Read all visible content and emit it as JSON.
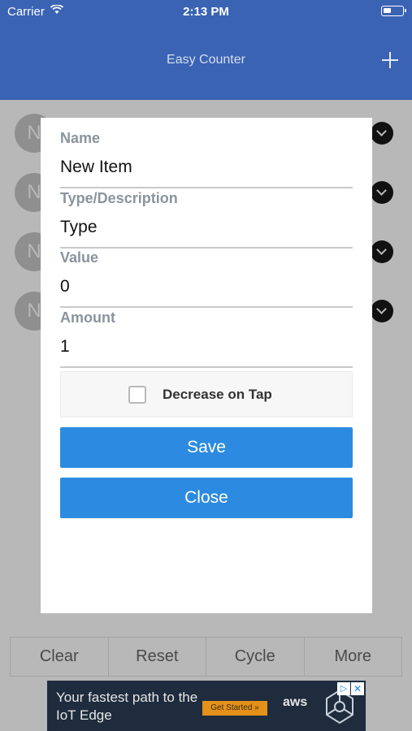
{
  "status": {
    "carrier": "Carrier",
    "time": "2:13 PM"
  },
  "nav": {
    "title": "Easy Counter",
    "add_icon": "plus-icon"
  },
  "list": {
    "avatar_letter": "N",
    "count": 4
  },
  "bottom_bar": {
    "clear": "Clear",
    "reset": "Reset",
    "cycle": "Cycle",
    "more": "More"
  },
  "ad": {
    "headline": "Your fastest path to the IoT Edge",
    "cta": "Get Started »",
    "brand": "aws",
    "info": "▷",
    "close": "✕"
  },
  "modal": {
    "name": {
      "label": "Name",
      "value": "New Item"
    },
    "type": {
      "label": "Type/Description",
      "value": "Type"
    },
    "value": {
      "label": "Value",
      "value": "0"
    },
    "amount": {
      "label": "Amount",
      "value": "1"
    },
    "decrease_on_tap": {
      "label": "Decrease on Tap",
      "checked": false
    },
    "save_label": "Save",
    "close_label": "Close"
  },
  "colors": {
    "header": "#3a63b4",
    "button": "#2c8be0",
    "overlay": "#b8b8b8"
  }
}
